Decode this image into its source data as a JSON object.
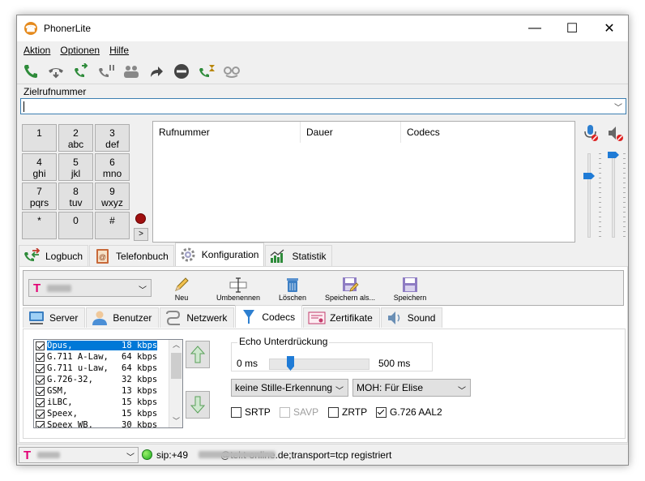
{
  "window": {
    "title": "PhonerLite"
  },
  "window_controls": {
    "minimize": "—",
    "maximize": "☐",
    "close": "✕"
  },
  "menu": [
    "Aktion",
    "Optionen",
    "Hilfe"
  ],
  "target": {
    "label": "Zielrufnummer",
    "value": ""
  },
  "keypad": [
    {
      "main": "1",
      "sub": ""
    },
    {
      "main": "2",
      "sub": "abc"
    },
    {
      "main": "3",
      "sub": "def"
    },
    {
      "main": "4",
      "sub": "ghi"
    },
    {
      "main": "5",
      "sub": "jkl"
    },
    {
      "main": "6",
      "sub": "mno"
    },
    {
      "main": "7",
      "sub": "pqrs"
    },
    {
      "main": "8",
      "sub": "tuv"
    },
    {
      "main": "9",
      "sub": "wxyz"
    },
    {
      "main": "*",
      "sub": ""
    },
    {
      "main": "0",
      "sub": ""
    },
    {
      "main": "#",
      "sub": ""
    }
  ],
  "more_button": ">",
  "calls_table": {
    "columns": [
      "Rufnummer",
      "Dauer",
      "Codecs"
    ]
  },
  "main_tabs": [
    "Logbuch",
    "Telefonbuch",
    "Konfiguration",
    "Statistik"
  ],
  "main_tab_active": "Konfiguration",
  "profile": {
    "brand": "T",
    "tools": [
      "Neu",
      "Umbenennen",
      "Löschen",
      "Speichern als...",
      "Speichern"
    ]
  },
  "sub_tabs": [
    "Server",
    "Benutzer",
    "Netzwerk",
    "Codecs",
    "Zertifikate",
    "Sound"
  ],
  "sub_tab_active": "Codecs",
  "codecs": [
    {
      "name": "Opus,",
      "rate": "18 kbps",
      "checked": true,
      "selected": true
    },
    {
      "name": "G.711 A-Law,",
      "rate": "64 kbps",
      "checked": true,
      "selected": false
    },
    {
      "name": "G.711 u-Law,",
      "rate": "64 kbps",
      "checked": true,
      "selected": false
    },
    {
      "name": "G.726-32,",
      "rate": "32 kbps",
      "checked": true,
      "selected": false
    },
    {
      "name": "GSM,",
      "rate": "13 kbps",
      "checked": true,
      "selected": false
    },
    {
      "name": "iLBC,",
      "rate": "15 kbps",
      "checked": true,
      "selected": false
    },
    {
      "name": "Speex,",
      "rate": "15 kbps",
      "checked": true,
      "selected": false
    },
    {
      "name": "Speex WB,",
      "rate": "30 kbps",
      "checked": true,
      "selected": false
    }
  ],
  "echo": {
    "title": "Echo Unterdrückung",
    "min_label": "0 ms",
    "max_label": "500 ms",
    "value_ms": 100
  },
  "silence_select": "keine Stille-Erkennung",
  "moh_select": "MOH: Für Elise",
  "options": [
    {
      "label": "SRTP",
      "checked": false,
      "enabled": true
    },
    {
      "label": "SAVP",
      "checked": false,
      "enabled": false
    },
    {
      "label": "ZRTP",
      "checked": false,
      "enabled": true
    },
    {
      "label": "G.726 AAL2",
      "checked": true,
      "enabled": true
    }
  ],
  "status": {
    "brand": "T",
    "registration": "sip:+49            @tel.t-online.de;transport=tcp registriert"
  },
  "colors": {
    "accent": "#0078d7",
    "brand": "#e20074",
    "slider": "#1f7bd6",
    "online": "#1fae1f"
  }
}
